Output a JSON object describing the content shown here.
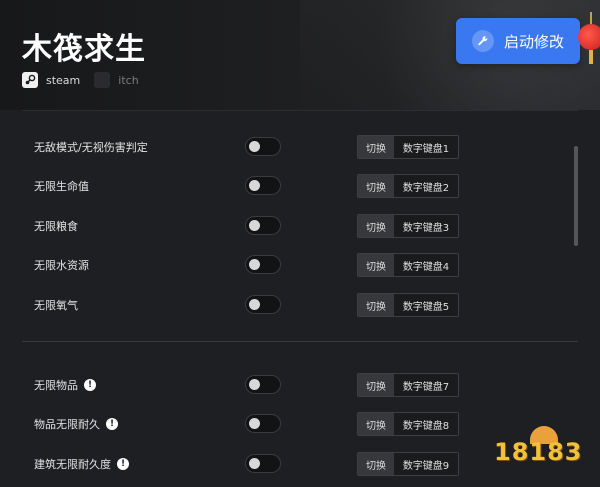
{
  "app": {
    "title": "木筏求生",
    "start_button_label": "启动修改",
    "platforms": [
      {
        "label": "steam",
        "icon": "steam-icon"
      },
      {
        "label": "itch",
        "icon": "itch-icon"
      }
    ]
  },
  "cheats": {
    "switch_label": "切换",
    "section1": [
      {
        "label": "无敌模式/无视伤害判定",
        "hotkey": "数字键盘1",
        "enabled": false
      },
      {
        "label": "无限生命值",
        "hotkey": "数字键盘2",
        "enabled": false
      },
      {
        "label": "无限粮食",
        "hotkey": "数字键盘3",
        "enabled": false
      },
      {
        "label": "无限水资源",
        "hotkey": "数字键盘4",
        "enabled": false
      },
      {
        "label": "无限氧气",
        "hotkey": "数字键盘5",
        "enabled": false
      }
    ],
    "section2": [
      {
        "label": "无限物品",
        "hotkey": "数字键盘7",
        "enabled": false,
        "info": true
      },
      {
        "label": "物品无限耐久",
        "hotkey": "数字键盘8",
        "enabled": false,
        "info": true
      },
      {
        "label": "建筑无限耐久度",
        "hotkey": "数字键盘9",
        "enabled": false,
        "info": true
      }
    ]
  },
  "info_glyph": "!",
  "watermark": {
    "text": "18183"
  },
  "colors": {
    "accent": "#3a78f2",
    "background": "#1e1f22",
    "header_bg": "#1b1c1f"
  }
}
